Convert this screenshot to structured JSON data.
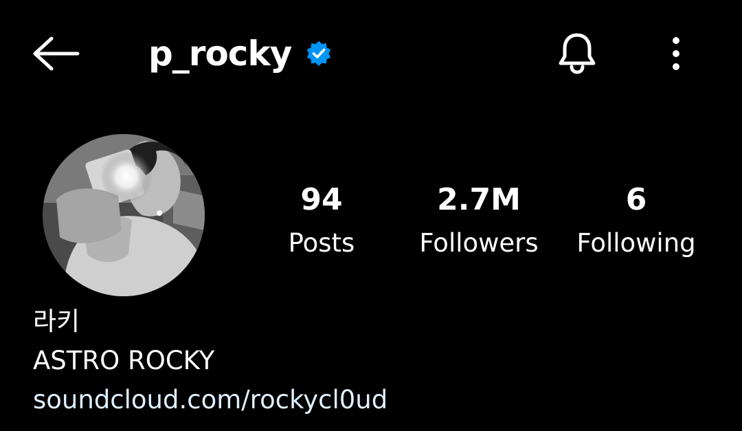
{
  "header": {
    "back_icon": "arrow-left-icon",
    "username": "p_rocky",
    "verified_icon": "verified-badge-icon",
    "verified_color": "#0095f6",
    "bell_icon": "bell-icon",
    "more_icon": "more-vertical-icon"
  },
  "profile": {
    "avatar": "profile-photo",
    "stats": {
      "posts": {
        "value": "94",
        "label": "Posts"
      },
      "followers": {
        "value": "2.7M",
        "label": "Followers"
      },
      "following": {
        "value": "6",
        "label": "Following"
      }
    },
    "display_name": "라키",
    "bio": "ASTRO ROCKY",
    "link": "soundcloud.com/rockycl0ud",
    "link_color": "#e0f1ff"
  },
  "theme": {
    "background": "#000000",
    "text": "#ffffff"
  }
}
